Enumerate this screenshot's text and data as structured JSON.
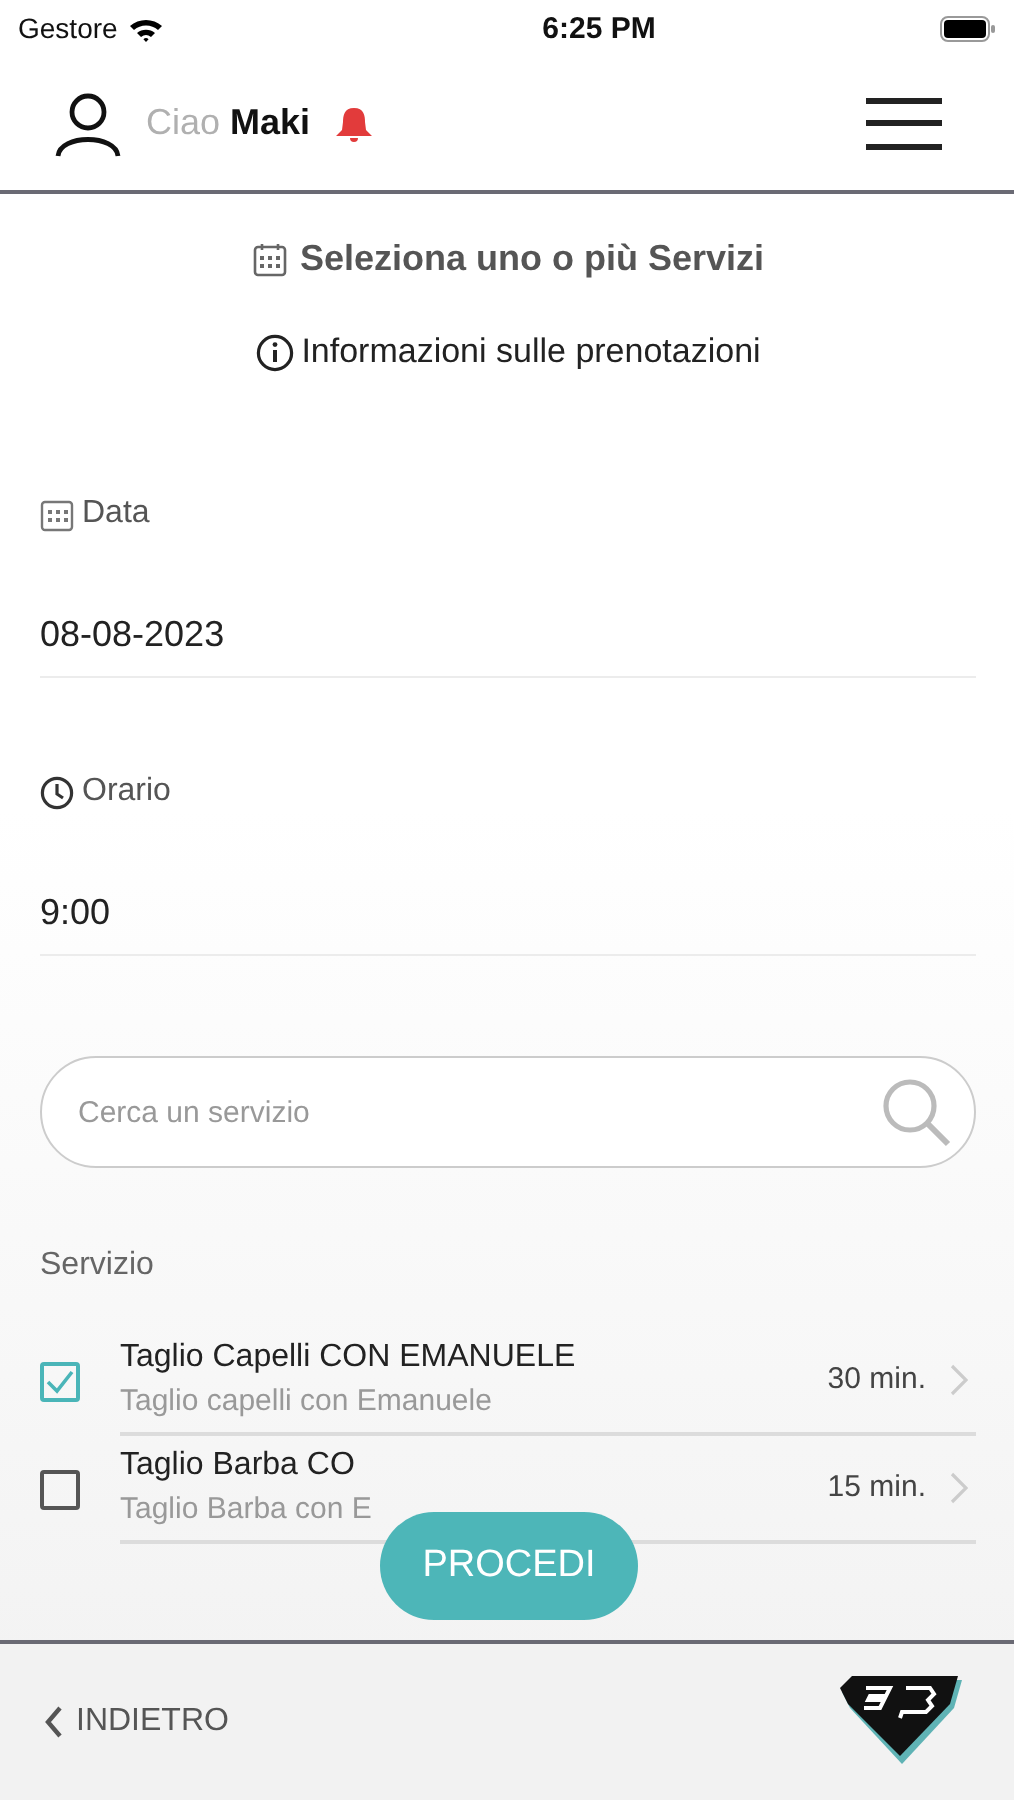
{
  "status_bar": {
    "carrier": "Gestore",
    "time": "6:25 PM"
  },
  "header": {
    "greeting": "Ciao",
    "user": "Maki"
  },
  "title": "Seleziona uno o più Servizi",
  "info_link": "Informazioni sulle prenotazioni",
  "fields": [
    {
      "kind": "date",
      "label": "Data",
      "value": "08-08-2023"
    },
    {
      "kind": "time",
      "label": "Orario",
      "value": "9:00"
    }
  ],
  "search": {
    "placeholder": "Cerca un servizio"
  },
  "section_label": "Servizio",
  "services": [
    {
      "name": "Taglio Capelli CON EMANUELE",
      "description": "Taglio capelli con Emanuele",
      "duration": "30 min.",
      "checked": true
    },
    {
      "name": "Taglio Barba CO",
      "description": "Taglio Barba con E",
      "duration": "15 min.",
      "checked": false
    }
  ],
  "procedi_button": "PROCEDI",
  "back_button": "INDIETRO"
}
